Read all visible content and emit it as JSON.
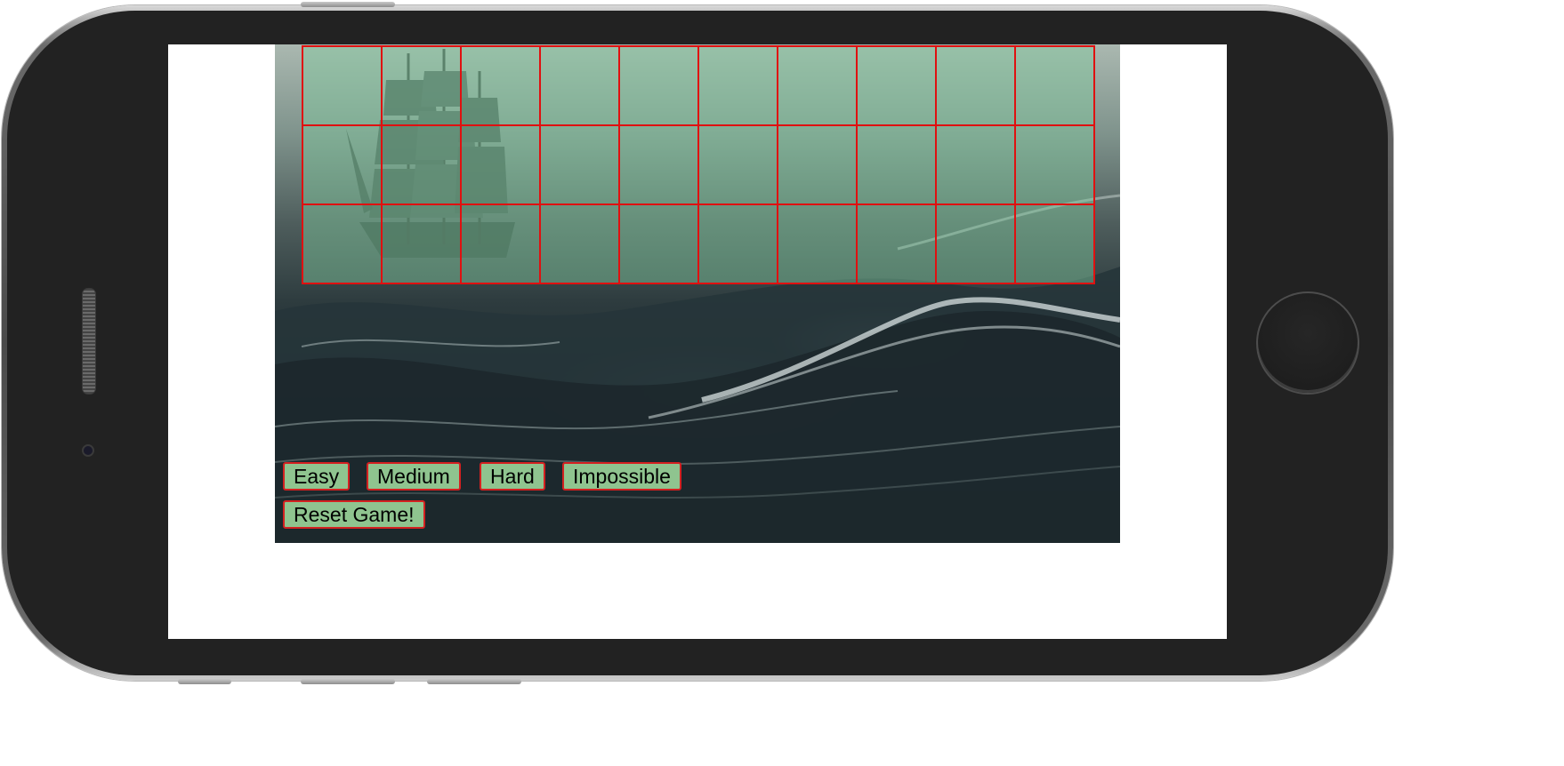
{
  "game": {
    "difficulty_buttons": [
      {
        "label": "Easy"
      },
      {
        "label": "Medium"
      },
      {
        "label": "Hard"
      },
      {
        "label": "Impossible"
      }
    ],
    "reset_label": "Reset Game!",
    "grid": {
      "rows": 3,
      "columns": 10
    },
    "colors": {
      "cell_fill": "#82cda0",
      "cell_border": "#e01010",
      "button_fill": "#8fc48f",
      "button_border": "#d42020"
    }
  }
}
